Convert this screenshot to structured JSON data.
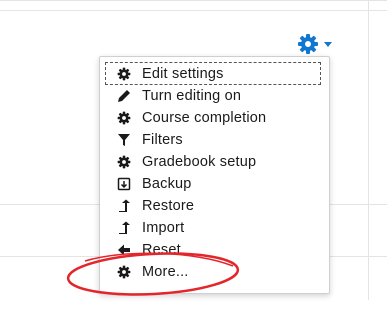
{
  "settings_toggle": {
    "icon": "gear-icon",
    "caret": "caret-down-icon",
    "color": "#1177d1"
  },
  "menu": {
    "items": [
      {
        "label": "Edit settings",
        "icon": "gear-icon"
      },
      {
        "label": "Turn editing on",
        "icon": "pencil-icon"
      },
      {
        "label": "Course completion",
        "icon": "gear-icon"
      },
      {
        "label": "Filters",
        "icon": "filter-icon"
      },
      {
        "label": "Gradebook setup",
        "icon": "gear-icon"
      },
      {
        "label": "Backup",
        "icon": "file-export-icon"
      },
      {
        "label": "Restore",
        "icon": "level-up-icon"
      },
      {
        "label": "Import",
        "icon": "level-up-icon"
      },
      {
        "label": "Reset",
        "icon": "arrow-left-icon"
      },
      {
        "label": "More...",
        "icon": "gear-icon"
      }
    ]
  },
  "annotation": {
    "color": "#e3262b"
  }
}
